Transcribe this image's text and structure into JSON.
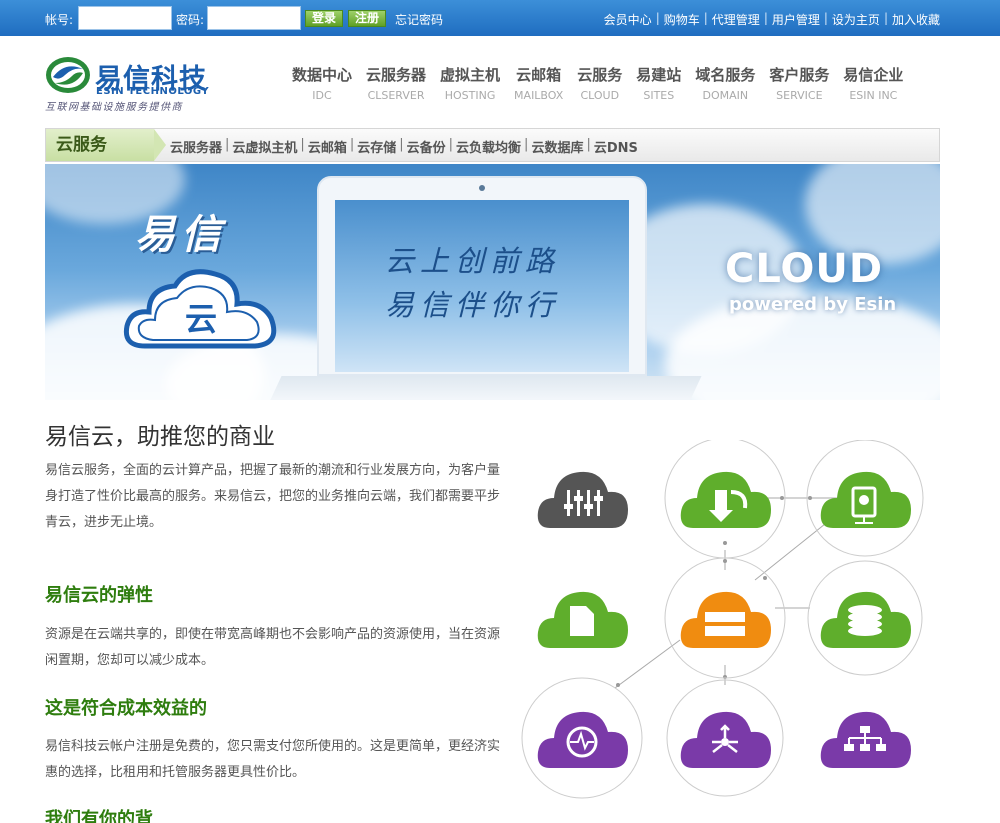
{
  "topbar": {
    "account_label": "帐号:",
    "password_label": "密码:",
    "login_label": "登录",
    "register_label": "注册",
    "forgot_label": "忘记密码",
    "links": [
      "会员中心",
      "购物车",
      "代理管理",
      "用户管理",
      "设为主页",
      "加入收藏"
    ]
  },
  "logo": {
    "name": "易信科技",
    "en": "ESIN TECHNOLOGY",
    "slogan": "互联网基础设施服务提供商"
  },
  "nav": [
    {
      "label": "数据中心",
      "sub": "IDC"
    },
    {
      "label": "云服务器",
      "sub": "CLSERVER"
    },
    {
      "label": "虚拟主机",
      "sub": "HOSTING"
    },
    {
      "label": "云邮箱",
      "sub": "MAILBOX"
    },
    {
      "label": "云服务",
      "sub": "CLOUD"
    },
    {
      "label": "易建站",
      "sub": "SITES"
    },
    {
      "label": "域名服务",
      "sub": "DOMAIN"
    },
    {
      "label": "客户服务",
      "sub": "SERVICE"
    },
    {
      "label": "易信企业",
      "sub": "ESIN INC"
    }
  ],
  "subnav": {
    "tag": "云服务",
    "links": [
      "云服务器",
      "云虚拟主机",
      "云邮箱",
      "云存储",
      "云备份",
      "云负载均衡",
      "云数据库",
      "云DNS"
    ]
  },
  "banner": {
    "brand": "易信",
    "badge": "云",
    "line1": "云上创前路",
    "line2": "易信伴你行",
    "cloud": "CLOUD",
    "powered": "powered by Esin"
  },
  "content": {
    "title": "易信云，助推您的商业",
    "intro": "易信云服务，全面的云计算产品，把握了最新的潮流和行业发展方向，为客户量身打造了性价比最高的服务。来易信云，把您的业务推向云端，我们都需要平步青云，进步无止境。",
    "sections": [
      {
        "heading": "易信云的弹性",
        "text": "资源是在云端共享的，即使在带宽高峰期也不会影响产品的资源使用，当在资源闲置期，您却可以减少成本。"
      },
      {
        "heading": "这是符合成本效益的",
        "text": "易信科技云帐户注册是免费的，您只需支付您所使用的。这是更简单，更经济实惠的选择，比租用和托管服务器更具性价比。"
      },
      {
        "heading": "我们有你的背",
        "text": ""
      }
    ]
  },
  "colors": {
    "topbar": "#1f6dc0",
    "green": "#2e7d0e",
    "cloud_green": "#5fae2c",
    "cloud_orange": "#f08c10",
    "cloud_purple": "#7a3aa8",
    "cloud_gray": "#555555"
  },
  "diagram_icons": [
    "settings-sliders-icon",
    "download-icon",
    "hard-drive-icon",
    "document-icon",
    "server-icon",
    "database-icon",
    "activity-icon",
    "share-arrows-icon",
    "network-tree-icon"
  ]
}
